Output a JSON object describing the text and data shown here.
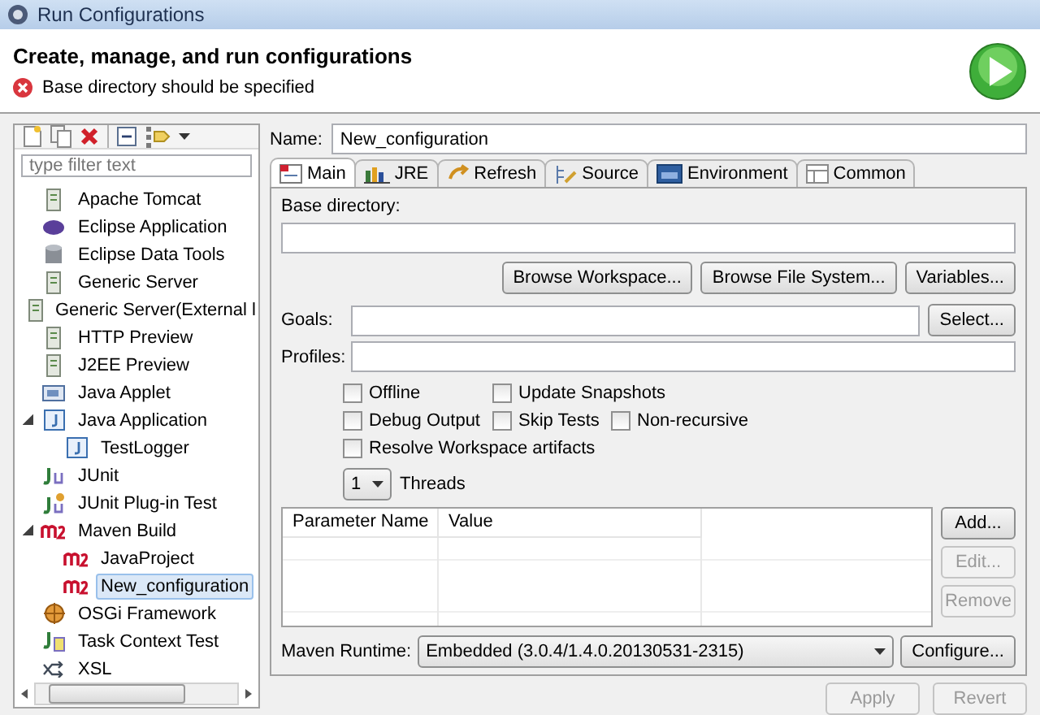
{
  "window": {
    "title": "Run Configurations"
  },
  "header": {
    "title": "Create, manage, and run configurations",
    "message": "Base directory should be specified"
  },
  "sidebar": {
    "filter": {
      "placeholder": "type filter text"
    },
    "tree": [
      {
        "label": "Apache Tomcat",
        "selected": false
      },
      {
        "label": "Eclipse Application",
        "selected": false
      },
      {
        "label": "Eclipse Data Tools",
        "selected": false
      },
      {
        "label": "Generic Server",
        "selected": false
      },
      {
        "label": "Generic Server(External l",
        "selected": false
      },
      {
        "label": "HTTP Preview",
        "selected": false
      },
      {
        "label": "J2EE Preview",
        "selected": false
      },
      {
        "label": "Java Applet",
        "selected": false
      },
      {
        "label": "Java Application",
        "selected": false,
        "expanded": true,
        "children": [
          {
            "label": "TestLogger",
            "selected": false
          }
        ]
      },
      {
        "label": "JUnit",
        "selected": false
      },
      {
        "label": "JUnit Plug-in Test",
        "selected": false
      },
      {
        "label": "Maven Build",
        "selected": false,
        "expanded": true,
        "children": [
          {
            "label": "JavaProject",
            "selected": false
          },
          {
            "label": "New_configuration",
            "selected": true
          }
        ]
      },
      {
        "label": "OSGi Framework",
        "selected": false
      },
      {
        "label": "Task Context Test",
        "selected": false
      },
      {
        "label": "XSL",
        "selected": false
      }
    ]
  },
  "name_field": {
    "label": "Name:",
    "value": "New_configuration"
  },
  "tabs": [
    {
      "label": "Main",
      "selected": true
    },
    {
      "label": "JRE",
      "selected": false
    },
    {
      "label": "Refresh",
      "selected": false
    },
    {
      "label": "Source",
      "selected": false
    },
    {
      "label": "Environment",
      "selected": false
    },
    {
      "label": "Common",
      "selected": false
    }
  ],
  "main": {
    "base_directory": {
      "label": "Base directory:"
    },
    "browse_buttons": [
      "Browse Workspace...",
      "Browse File System...",
      "Variables..."
    ],
    "goals": {
      "label": "Goals:",
      "button": "Select..."
    },
    "profiles": {
      "label": "Profiles:"
    },
    "options": [
      [
        {
          "label": "Offline",
          "checked": false
        },
        {
          "label": "Update Snapshots",
          "checked": false
        }
      ],
      [
        {
          "label": "Debug Output",
          "checked": false
        },
        {
          "label": "Skip Tests",
          "checked": false
        },
        {
          "label": "Non-recursive",
          "checked": false
        }
      ],
      [
        {
          "label": "Resolve Workspace artifacts",
          "checked": false
        }
      ]
    ],
    "threads": {
      "value": "1",
      "label": "Threads"
    },
    "parameters": {
      "columns": [
        "Parameter Name",
        "Value"
      ],
      "buttons": [
        {
          "label": "Add...",
          "disabled": false
        },
        {
          "label": "Edit...",
          "disabled": true
        },
        {
          "label": "Remove",
          "disabled": true
        }
      ]
    },
    "runtime": {
      "label": "Maven Runtime:",
      "value": "Embedded (3.0.4/1.4.0.20130531-2315)",
      "button": "Configure..."
    }
  },
  "footer_buttons": [
    {
      "label": "Apply",
      "disabled": true
    },
    {
      "label": "Revert",
      "disabled": true
    }
  ]
}
